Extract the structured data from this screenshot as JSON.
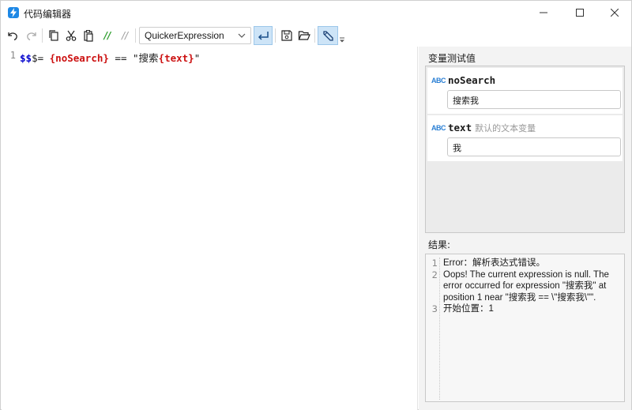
{
  "window": {
    "title": "代码编辑器"
  },
  "toolbar": {
    "mode_select": "QuickerExpression",
    "comment_label": "//",
    "uncomment_label": "//"
  },
  "editor": {
    "lines": [
      {
        "number": "1",
        "tokens": [
          {
            "text": "$$",
            "style": "blue"
          },
          {
            "text": "$= ",
            "style": "plain"
          },
          {
            "text": "{noSearch}",
            "style": "red"
          },
          {
            "text": " == \"搜索",
            "style": "plain"
          },
          {
            "text": "{text}",
            "style": "red"
          },
          {
            "text": "\"",
            "style": "plain"
          }
        ]
      }
    ]
  },
  "variables_panel": {
    "label": "变量测试值",
    "items": [
      {
        "type_icon": "ABC",
        "name": "noSearch",
        "description": "",
        "value": "搜索我"
      },
      {
        "type_icon": "ABC",
        "name": "text",
        "description": "默认的文本变量",
        "value": "我"
      }
    ]
  },
  "result_panel": {
    "label": "结果:",
    "lines": [
      {
        "number": "1",
        "text": "Error：解析表达式错误。"
      },
      {
        "number": "2",
        "text": "Oops! The current expression is null. The error occurred for expression \"搜索我\" at position 1 near \"搜索我 == \\\"搜索我\\\"\"."
      },
      {
        "number": "3",
        "text": "开始位置：1"
      }
    ]
  },
  "colors": {
    "keyword_blue": "#0000cc",
    "variable_red": "#cc1111",
    "type_icon_blue": "#2a7fd4",
    "comment_green": "#2e9e2e",
    "app_icon_blue": "#1e88e5"
  }
}
